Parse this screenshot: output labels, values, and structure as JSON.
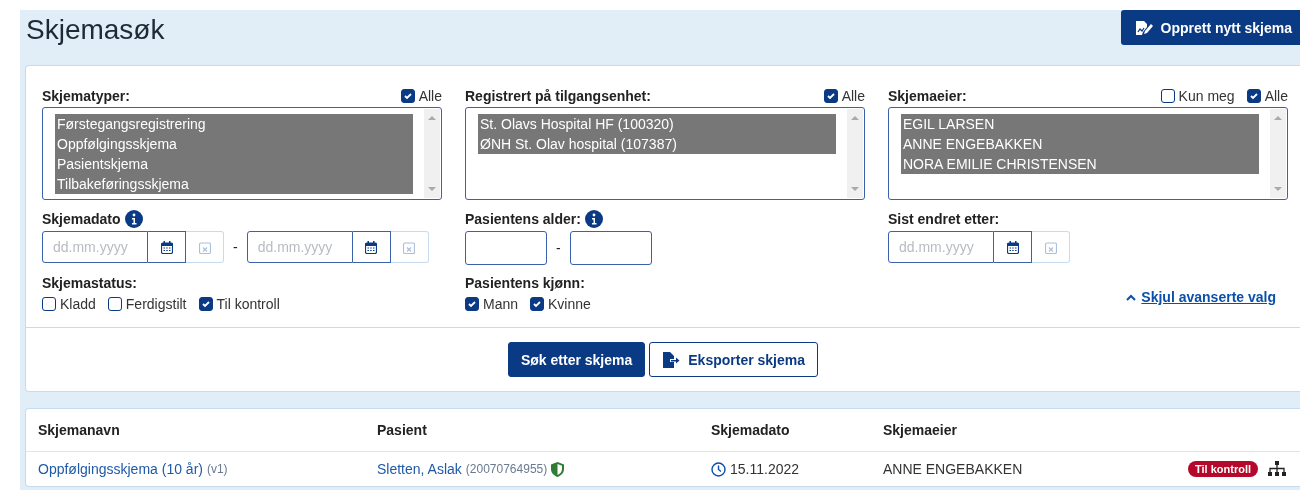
{
  "page": {
    "title": "Skjemasøk",
    "create_button": "Opprett nytt skjema"
  },
  "filters": {
    "lists": [
      {
        "label": "Skjematyper:",
        "options": [
          {
            "label": "Alle",
            "checked": true
          }
        ],
        "items": [
          {
            "text": "Førstegangsregistrering",
            "selected": true
          },
          {
            "text": "Oppfølgingsskjema",
            "selected": true
          },
          {
            "text": "Pasientskjema",
            "selected": true
          },
          {
            "text": "Tilbakeføringsskjema",
            "selected": true
          }
        ]
      },
      {
        "label": "Registrert på tilgangsenhet:",
        "options": [
          {
            "label": "Alle",
            "checked": true
          }
        ],
        "items": [
          {
            "text": "St. Olavs Hospital HF (100320)",
            "selected": true
          },
          {
            "text": "ØNH St. Olav hospital (107387)",
            "selected": true
          }
        ]
      },
      {
        "label": "Skjemaeier:",
        "options": [
          {
            "label": "Kun meg",
            "checked": false
          },
          {
            "label": "Alle",
            "checked": true
          }
        ],
        "items": [
          {
            "text": "EGIL LARSEN",
            "selected": true
          },
          {
            "text": "ANNE ENGEBAKKEN",
            "selected": true
          },
          {
            "text": "NORA EMILIE CHRISTENSEN",
            "selected": true
          }
        ]
      }
    ],
    "form_date": {
      "label": "Skjemadato",
      "from": {
        "placeholder": "dd.mm.yyyy"
      },
      "separator": "-",
      "to": {
        "placeholder": "dd.mm.yyyy"
      }
    },
    "age": {
      "label": "Pasientens alder:",
      "separator": "-"
    },
    "changed_after": {
      "label": "Sist endret etter:",
      "placeholder": "dd.mm.yyyy"
    },
    "status": {
      "label": "Skjemastatus:",
      "options": [
        {
          "label": "Kladd",
          "checked": false
        },
        {
          "label": "Ferdigstilt",
          "checked": false
        },
        {
          "label": "Til kontroll",
          "checked": true
        }
      ]
    },
    "gender": {
      "label": "Pasientens kjønn:",
      "options": [
        {
          "label": "Mann",
          "checked": true
        },
        {
          "label": "Kvinne",
          "checked": true
        }
      ]
    },
    "toggle_link": "Skjul avanserte valg"
  },
  "actions": [
    {
      "label": "Søk etter skjema",
      "kind": "primary"
    },
    {
      "label": "Eksporter skjema",
      "kind": "secondary"
    }
  ],
  "table": {
    "columns": [
      "Skjemanavn",
      "Pasient",
      "Skjemadato",
      "Skjemaeier"
    ],
    "rows": [
      {
        "name": "Oppfølgingsskjema (10 år)",
        "version": "(v1)",
        "patient": "Sletten, Aslak",
        "patient_id": "(20070764955)",
        "date": "15.11.2022",
        "owner": "ANNE ENGEBAKKEN",
        "status": "Til kontroll"
      }
    ]
  }
}
